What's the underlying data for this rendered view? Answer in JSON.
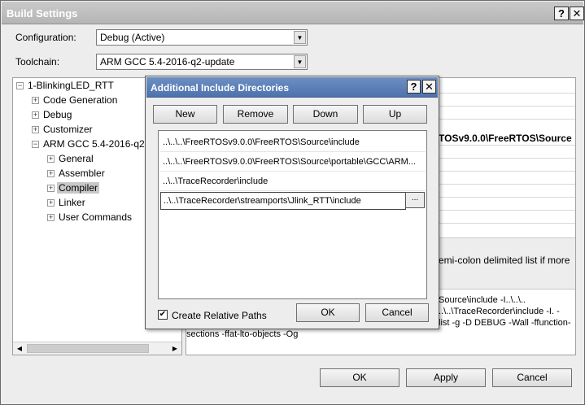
{
  "window": {
    "title": "Build Settings",
    "help": "?",
    "close": "✕"
  },
  "configuration": {
    "label": "Configuration:",
    "value": "Debug (Active)"
  },
  "toolchain": {
    "label": "Toolchain:",
    "value": "ARM GCC 5.4-2016-q2-update"
  },
  "tree": {
    "root": "1-BlinkingLED_RTT",
    "items": [
      "Code Generation",
      "Debug",
      "Customizer",
      "ARM GCC 5.4-2016-q2"
    ],
    "children": [
      "General",
      "Assembler",
      "Compiler",
      "Linker",
      "User Commands"
    ]
  },
  "right_panel": {
    "path_fragment": "TOSv9.0.0\\FreeRTOS\\Source",
    "desc_fragment": "emi-colon delimited list if more",
    "cmd_line1": "Source\\include -I..\\..\\..",
    "cmd_line2": "..\\..\\TraceRecorder\\include -I. -",
    "cmd_line3": "list -g -D DEBUG -Wall -ffunction-",
    "cmd_line4": "sections -ffat-lto-objects -Og"
  },
  "footer": {
    "ok": "OK",
    "apply": "Apply",
    "cancel": "Cancel"
  },
  "dialog": {
    "title": "Additional Include Directories",
    "help": "?",
    "close": "✕",
    "buttons": {
      "new": "New",
      "remove": "Remove",
      "down": "Down",
      "up": "Up"
    },
    "entries": [
      "..\\..\\..\\FreeRTOSv9.0.0\\FreeRTOS\\Source\\include",
      "..\\..\\..\\FreeRTOSv9.0.0\\FreeRTOS\\Source\\portable\\GCC\\ARM...",
      "..\\..\\TraceRecorder\\include"
    ],
    "editing_value": "..\\..\\TraceRecorder\\streamports\\Jlink_RTT\\include",
    "browse": "...",
    "checkbox": {
      "label": "Create Relative Paths",
      "checked": true
    },
    "ok": "OK",
    "cancel": "Cancel"
  }
}
